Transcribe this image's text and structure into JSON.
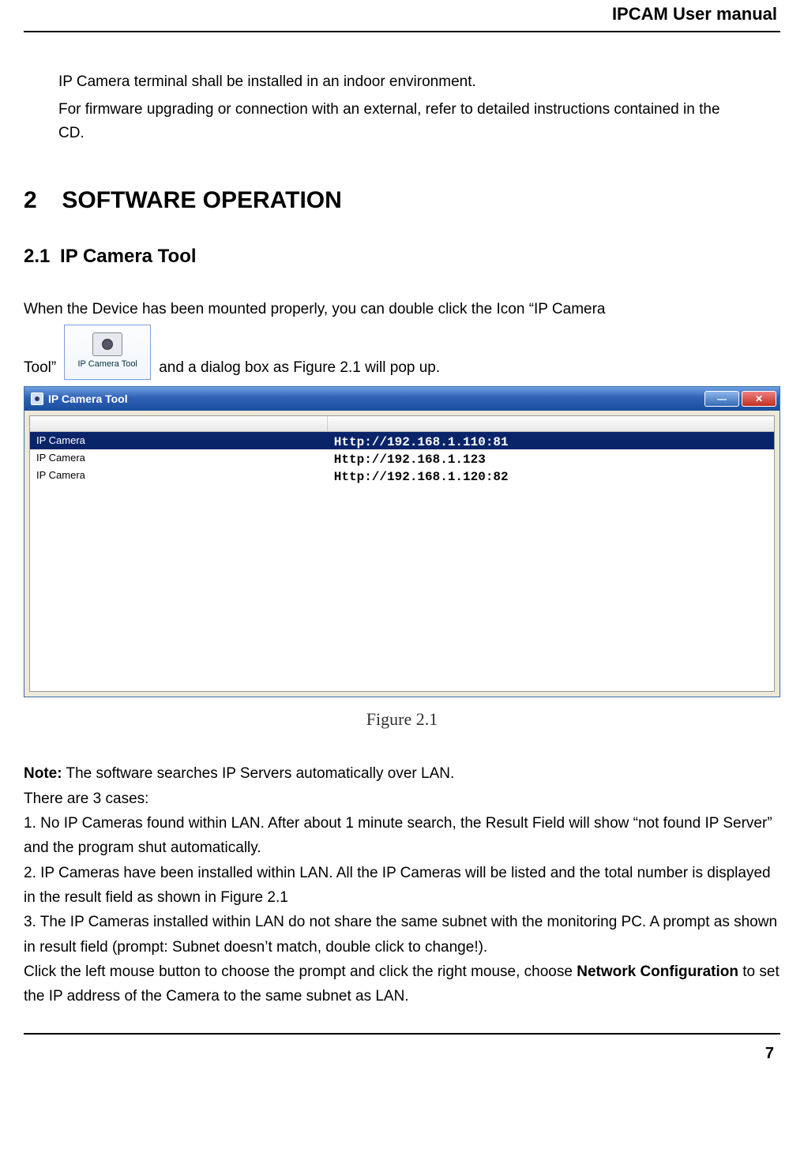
{
  "header": {
    "title": "IPCAM User manual"
  },
  "intro": {
    "p1": "IP Camera terminal shall be installed in an indoor environment.",
    "p2": "For firmware upgrading or connection with an external, refer to detailed instructions contained in the CD."
  },
  "section": {
    "num": "2",
    "title": "SOFTWARE OPERATION"
  },
  "subsection": {
    "num": "2.1",
    "title": "IP Camera Tool"
  },
  "sentence": {
    "pre": "When the Device has been mounted properly, you can double click the Icon “IP Camera",
    "tool_word": "Tool”",
    "post": "and a dialog box as Figure 2.1 will pop up."
  },
  "desktopIcon": {
    "label": "IP Camera Tool"
  },
  "appWindow": {
    "title": "IP Camera Tool",
    "cameras": [
      {
        "name": "IP Camera",
        "url": "Http://192.168.1.110:81",
        "selected": true
      },
      {
        "name": "IP Camera",
        "url": "Http://192.168.1.123",
        "selected": false
      },
      {
        "name": "IP Camera",
        "url": "Http://192.168.1.120:82",
        "selected": false
      }
    ]
  },
  "figure": {
    "caption": "Figure 2.1"
  },
  "note": {
    "label": "Note:",
    "text": " The software searches IP Servers automatically over LAN.",
    "casesIntro": "There are 3 cases:",
    "case1": "1. No IP Cameras found within LAN. After about 1 minute search, the Result Field will show “not found IP Server” and the program shut automatically.",
    "case2": "2. IP Cameras have been installed within LAN. All the IP Cameras will be listed and the total number is displayed in the result field as shown in Figure 2.1",
    "case3": "3. The IP Cameras installed within LAN do not share the same subnet with the monitoring PC. A prompt as shown in result field (prompt: Subnet doesn’t match, double click to change!).",
    "afterPre": "Click the left mouse button to choose the prompt and click the right mouse, choose ",
    "afterBold": "Network Configuration",
    "afterPost": " to set the IP address of the Camera to the same subnet as LAN."
  },
  "pageNumber": "7"
}
